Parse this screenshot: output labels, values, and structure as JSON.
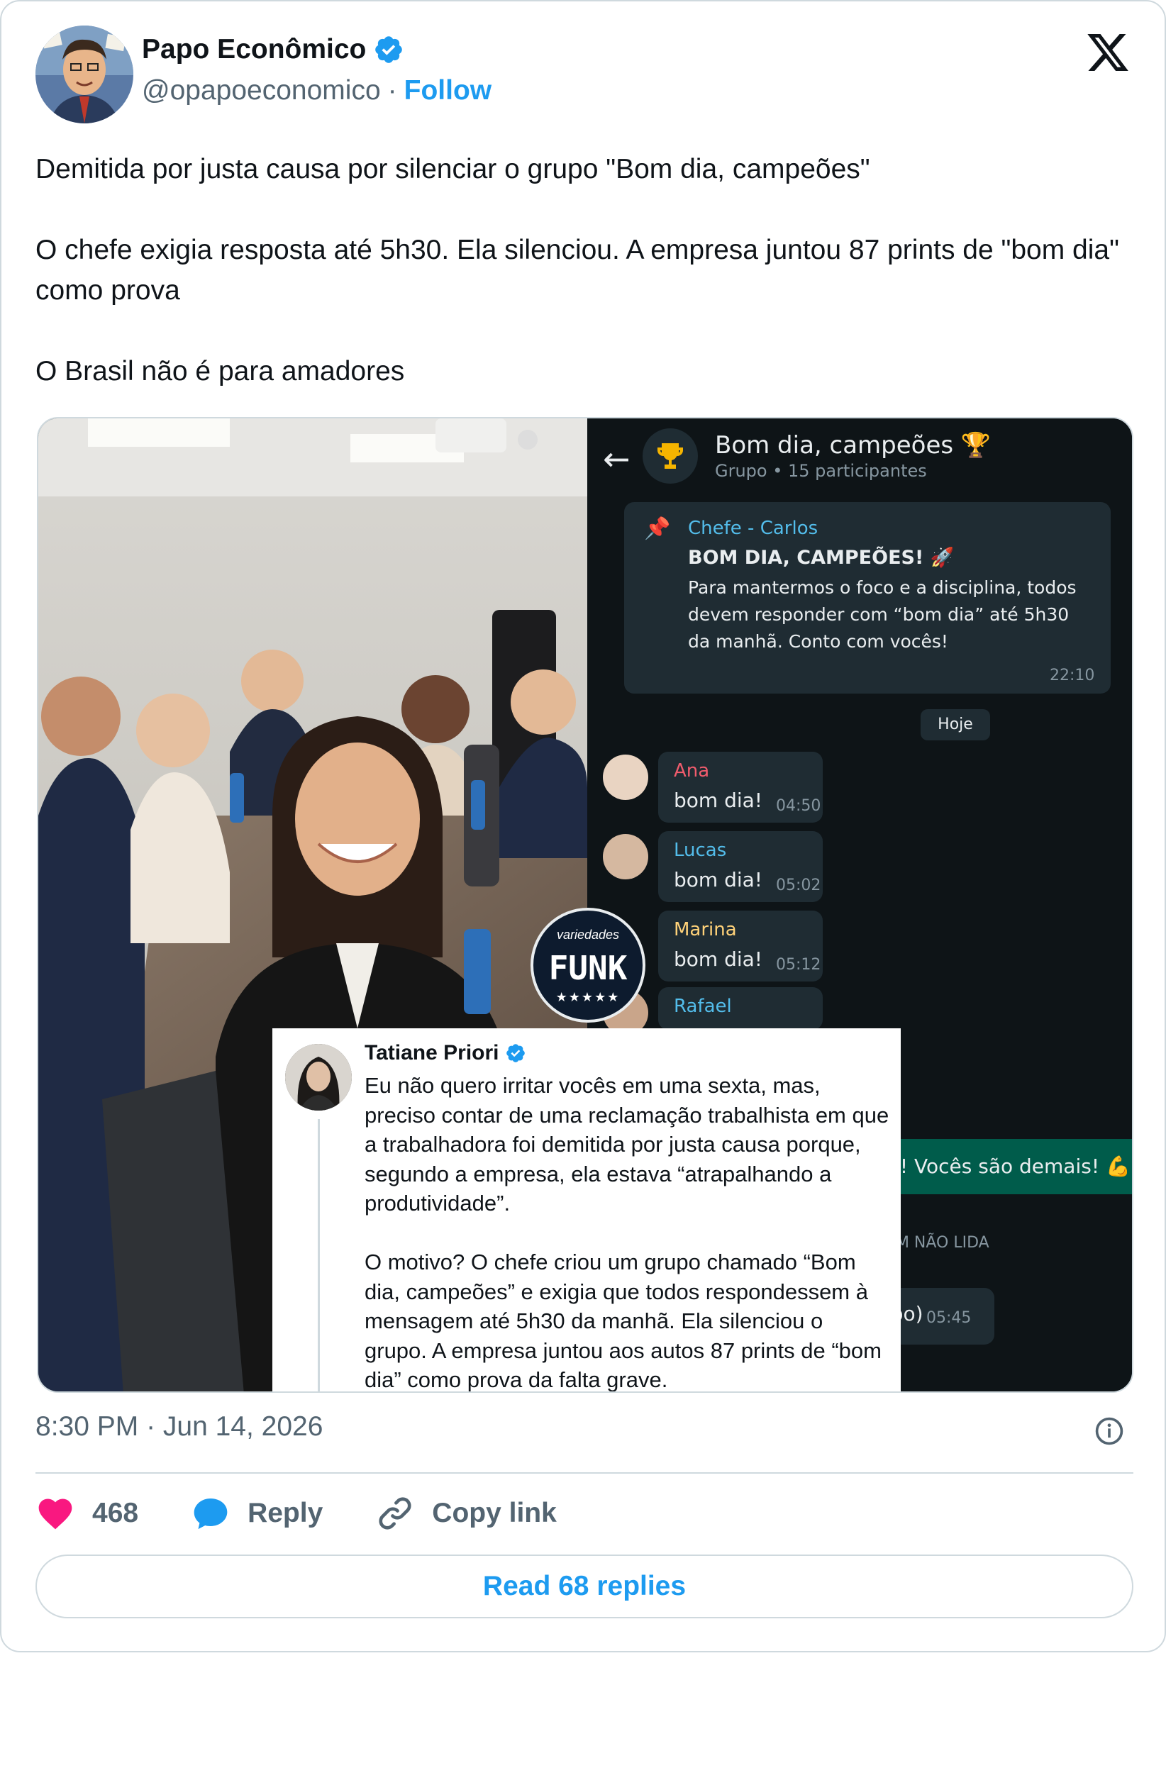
{
  "author": {
    "name": "Papo Econômico",
    "handle": "@opapoeconomico",
    "separator": "·",
    "follow_label": "Follow"
  },
  "post": {
    "paragraphs": [
      "Demitida por justa causa por silenciar o grupo \"Bom dia, campeões\"",
      "O chefe exigia resposta até 5h30. Ela silenciou. A empresa juntou 87 prints de \"bom dia\" como prova",
      "O Brasil não é para amadores"
    ]
  },
  "media": {
    "chat": {
      "group_name": "Bom dia, campeões 🏆",
      "group_info": "Grupo • 15 participantes",
      "pinned": {
        "sender": "Chefe - Carlos",
        "headline": "BOM DIA, CAMPEÕES! 🚀",
        "body": "Para mantermos o foco e a disciplina, todos devem responder com “bom dia” até 5h30 da manhã. Conto com vocês!",
        "time": "22:10"
      },
      "day_label": "Hoje",
      "messages": [
        {
          "sender": "Ana",
          "text": "bom dia!",
          "time": "04:50",
          "color": "#f15c6d"
        },
        {
          "sender": "Lucas",
          "text": "bom dia!",
          "time": "05:02",
          "color": "#53bdeb"
        },
        {
          "sender": "Marina",
          "text": "bom dia!",
          "time": "05:12",
          "color": "#ffd279"
        },
        {
          "sender": "Rafael",
          "text": "",
          "time": "",
          "color": "#53bdeb"
        }
      ],
      "partial_reply": "lo! Vocês são demais! 💪",
      "unread_label": "GEM NÃO LIDA",
      "partial_reply2": "upo)",
      "partial_reply2_time": "05:45"
    },
    "watermark": {
      "top": "variedades",
      "main": "FUNK",
      "stars": "★★★★★"
    },
    "embedded_post": {
      "name": "Tatiane Priori",
      "paragraphs": [
        "Eu não quero irritar vocês em uma sexta, mas, preciso contar de uma reclamação trabalhista em que a trabalhadora foi demitida por justa causa porque, segundo a empresa, ela estava “atrapalhando a produtividade”.",
        "O motivo? O chefe criou um grupo chamado “Bom dia, campeões” e exigia que todos respondessem à mensagem até 5h30 da manhã. Ela silenciou o grupo. A empresa juntou aos autos 87 prints de “bom dia” como prova da falta grave."
      ]
    }
  },
  "meta": {
    "timestamp": "8:30 PM · Jun 14, 2026"
  },
  "actions": {
    "like_count": "468",
    "reply_label": "Reply",
    "copy_label": "Copy link",
    "read_replies_label": "Read 68 replies"
  },
  "colors": {
    "brand_blue": "#1d9bf0",
    "like_pink": "#f91880",
    "text_secondary": "#536471",
    "border": "#cfd9de"
  },
  "icons": [
    "verified-badge-icon",
    "x-logo-icon",
    "info-icon",
    "heart-icon",
    "reply-bubble-icon",
    "link-icon",
    "back-arrow-icon",
    "trophy-icon",
    "pin-icon"
  ]
}
